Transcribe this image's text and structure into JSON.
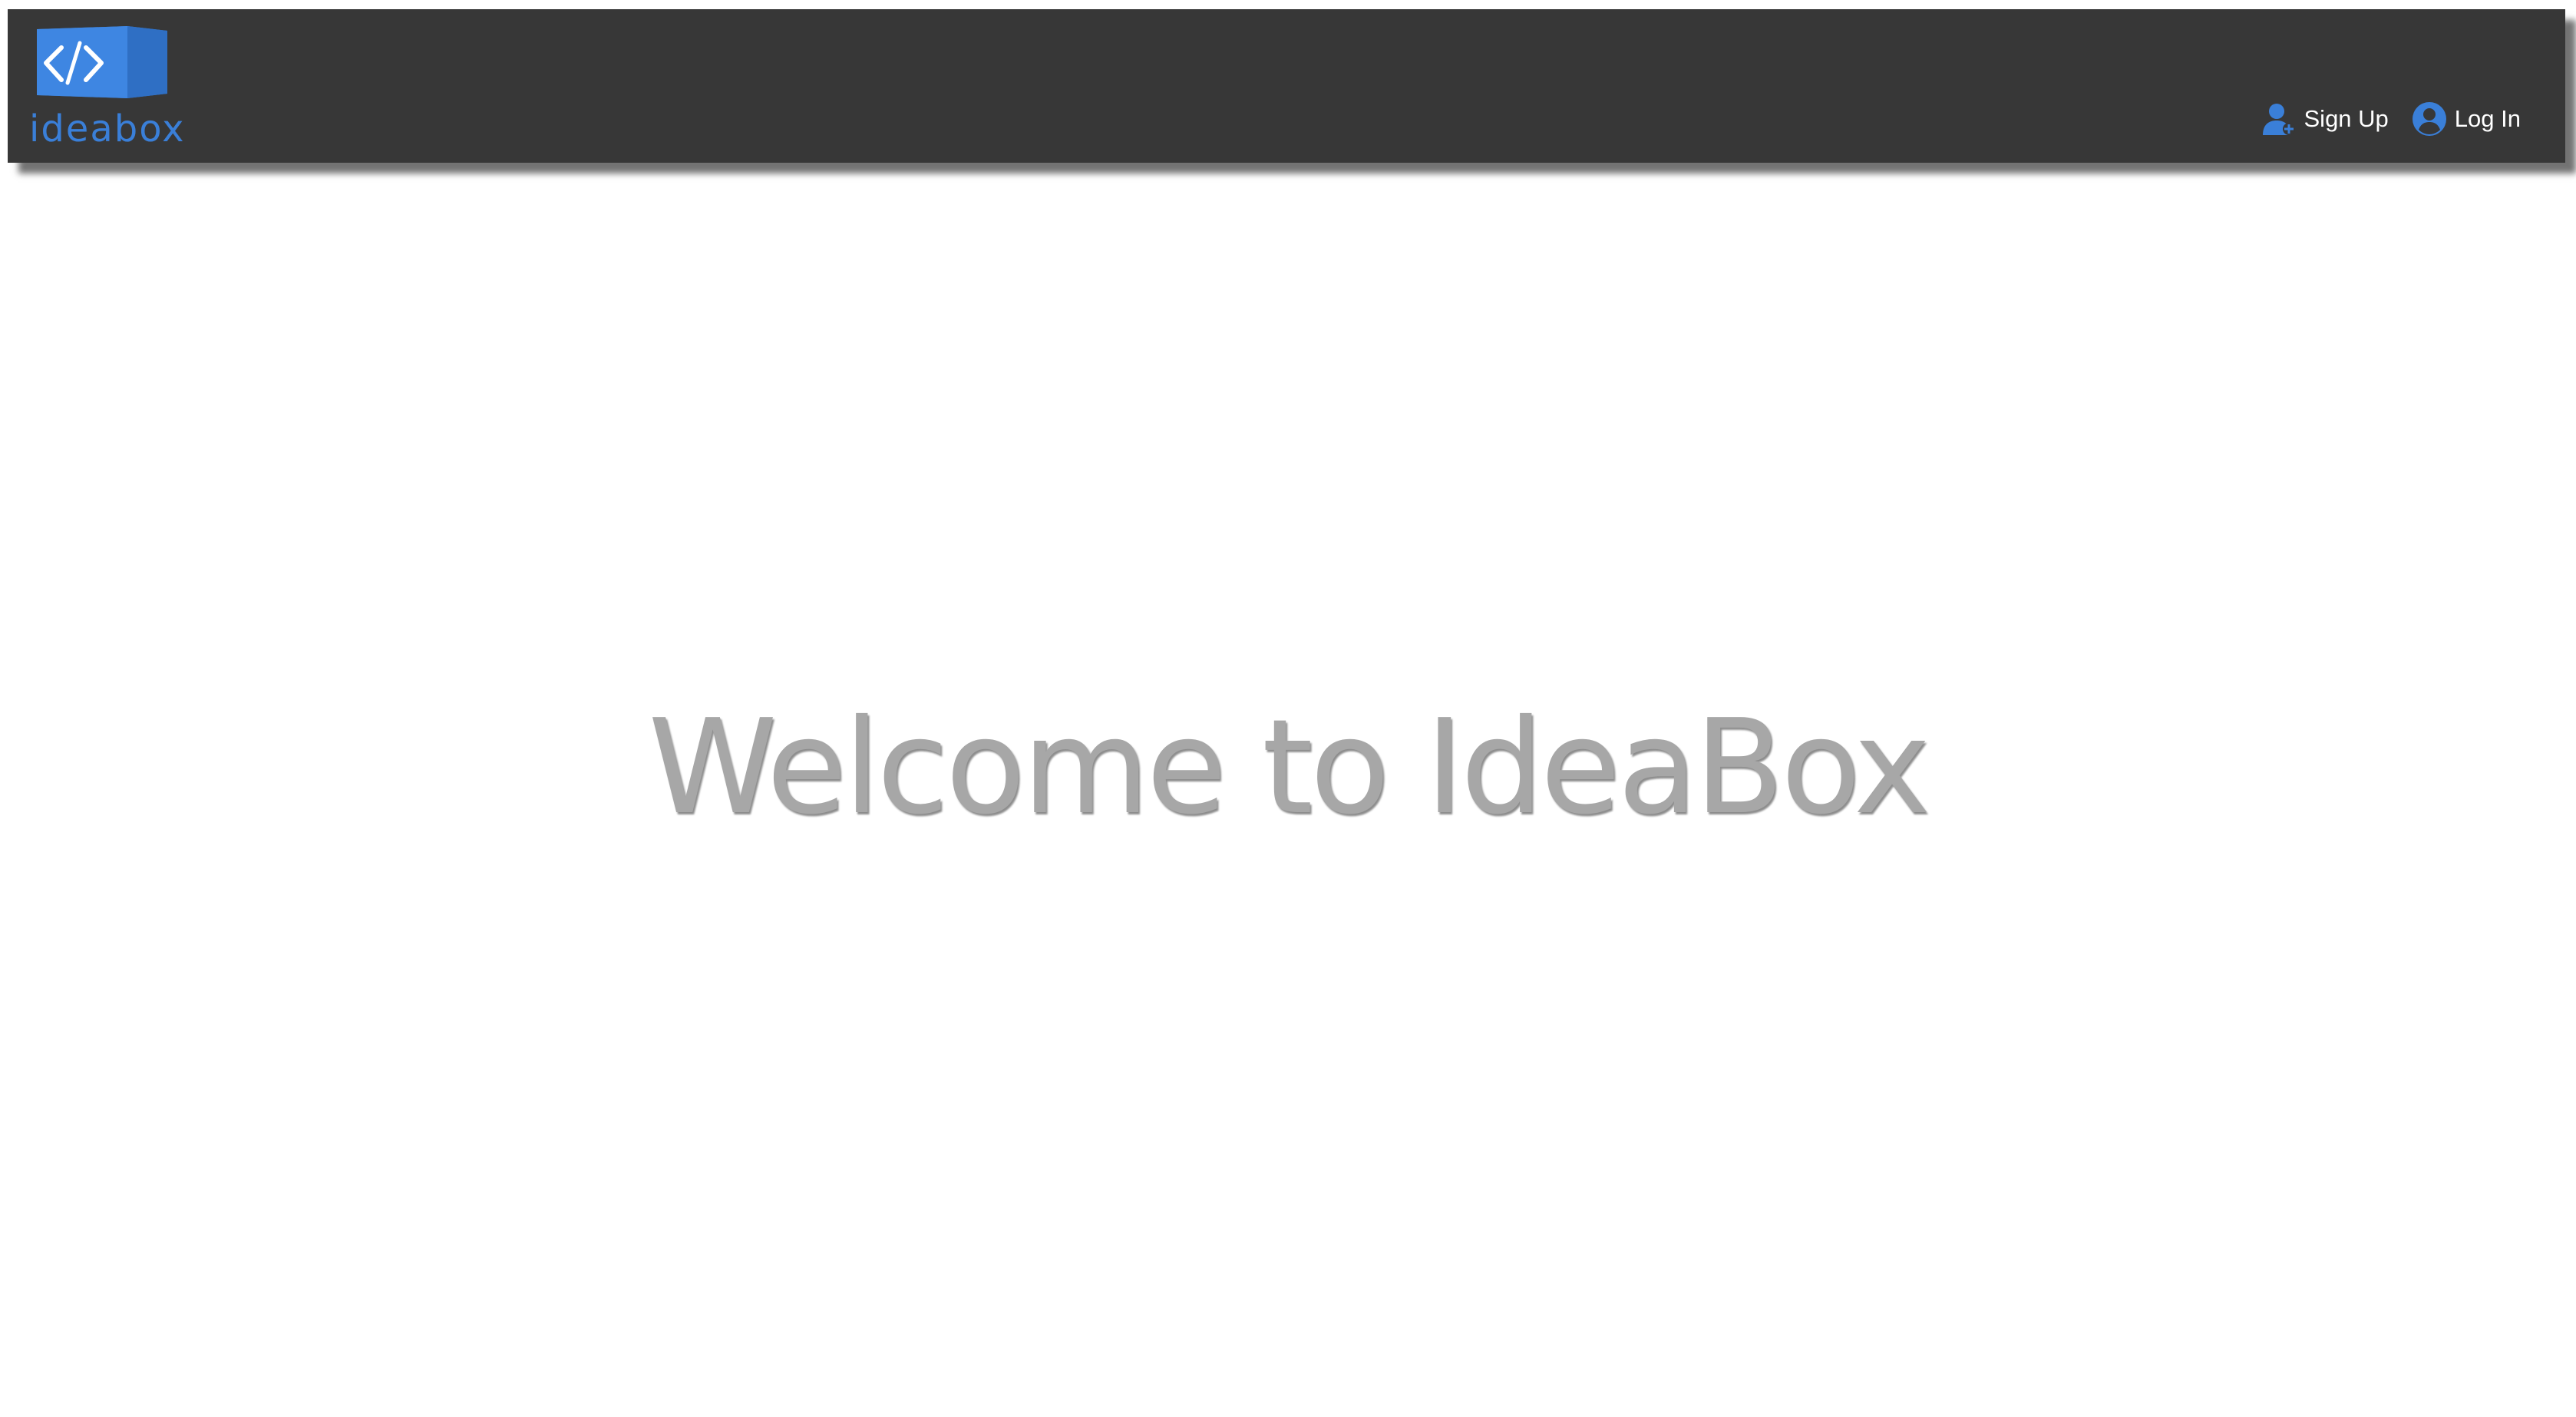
{
  "brand": {
    "logo_text": "ideabox",
    "logo_icon": "code-brackets-icon",
    "accent_color": "#3a7fd8"
  },
  "navbar": {
    "background_color": "#373737",
    "links": [
      {
        "label": "Sign Up",
        "icon": "user-plus-icon"
      },
      {
        "label": "Log In",
        "icon": "user-circle-icon"
      }
    ]
  },
  "hero": {
    "title": "Welcome to IdeaBox"
  }
}
